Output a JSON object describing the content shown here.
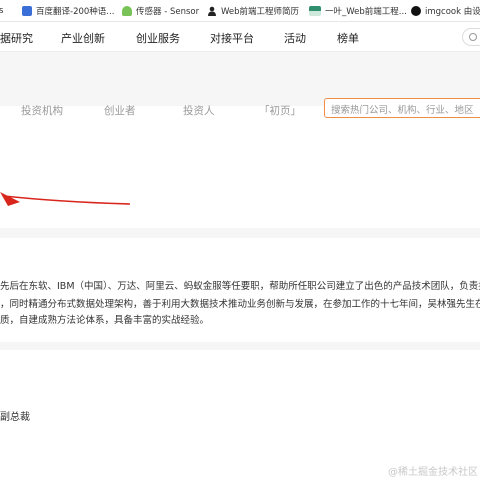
{
  "bookmarks": {
    "first_label": "s",
    "items": [
      {
        "label": "百度翻译-200种语...",
        "icon": "baidu-translate-icon",
        "color": "#3b6fd8"
      },
      {
        "label": "传感器 - Sensor",
        "icon": "android-icon",
        "color": "#78c257"
      },
      {
        "label": "Web前端工程师简历",
        "icon": "person-icon",
        "color": "#222222"
      },
      {
        "label": "一叶_Web前端工程...",
        "icon": "site-thumbnail-icon",
        "color": "#2f8f6f"
      },
      {
        "label": "imgcook 由设计",
        "icon": "imgcook-icon",
        "color": "#111111"
      }
    ]
  },
  "nav": {
    "items": [
      "据研究",
      "产业创新",
      "创业服务",
      "对接平台",
      "活动",
      "榜单"
    ]
  },
  "subnav": {
    "items": [
      "投资机构",
      "创业者",
      "投资人",
      "「初页」"
    ],
    "search_placeholder": "搜索热门公司、机构、行业、地区"
  },
  "bio": {
    "lines": [
      "先后在东软、IBM（中国）、万达、阿里云、蚂蚁金服等任要职，帮助所任职公司建立了出色的产品技术团队，负责技",
      "，同时精通分布式数据处理架构，善于利用大数据技术推动业务创新与发展，在参加工作的十七年间，吴林强先生在公",
      "质，自建成熟方法论体系，具备丰富的实战经验。"
    ]
  },
  "role": {
    "text": "副总裁"
  },
  "watermark": {
    "text": "@稀土掘金技术社区"
  },
  "colors": {
    "search_border": "#f08c4a",
    "annotation_arrow": "#d9261c",
    "page_gray": "#f6f6f6"
  }
}
